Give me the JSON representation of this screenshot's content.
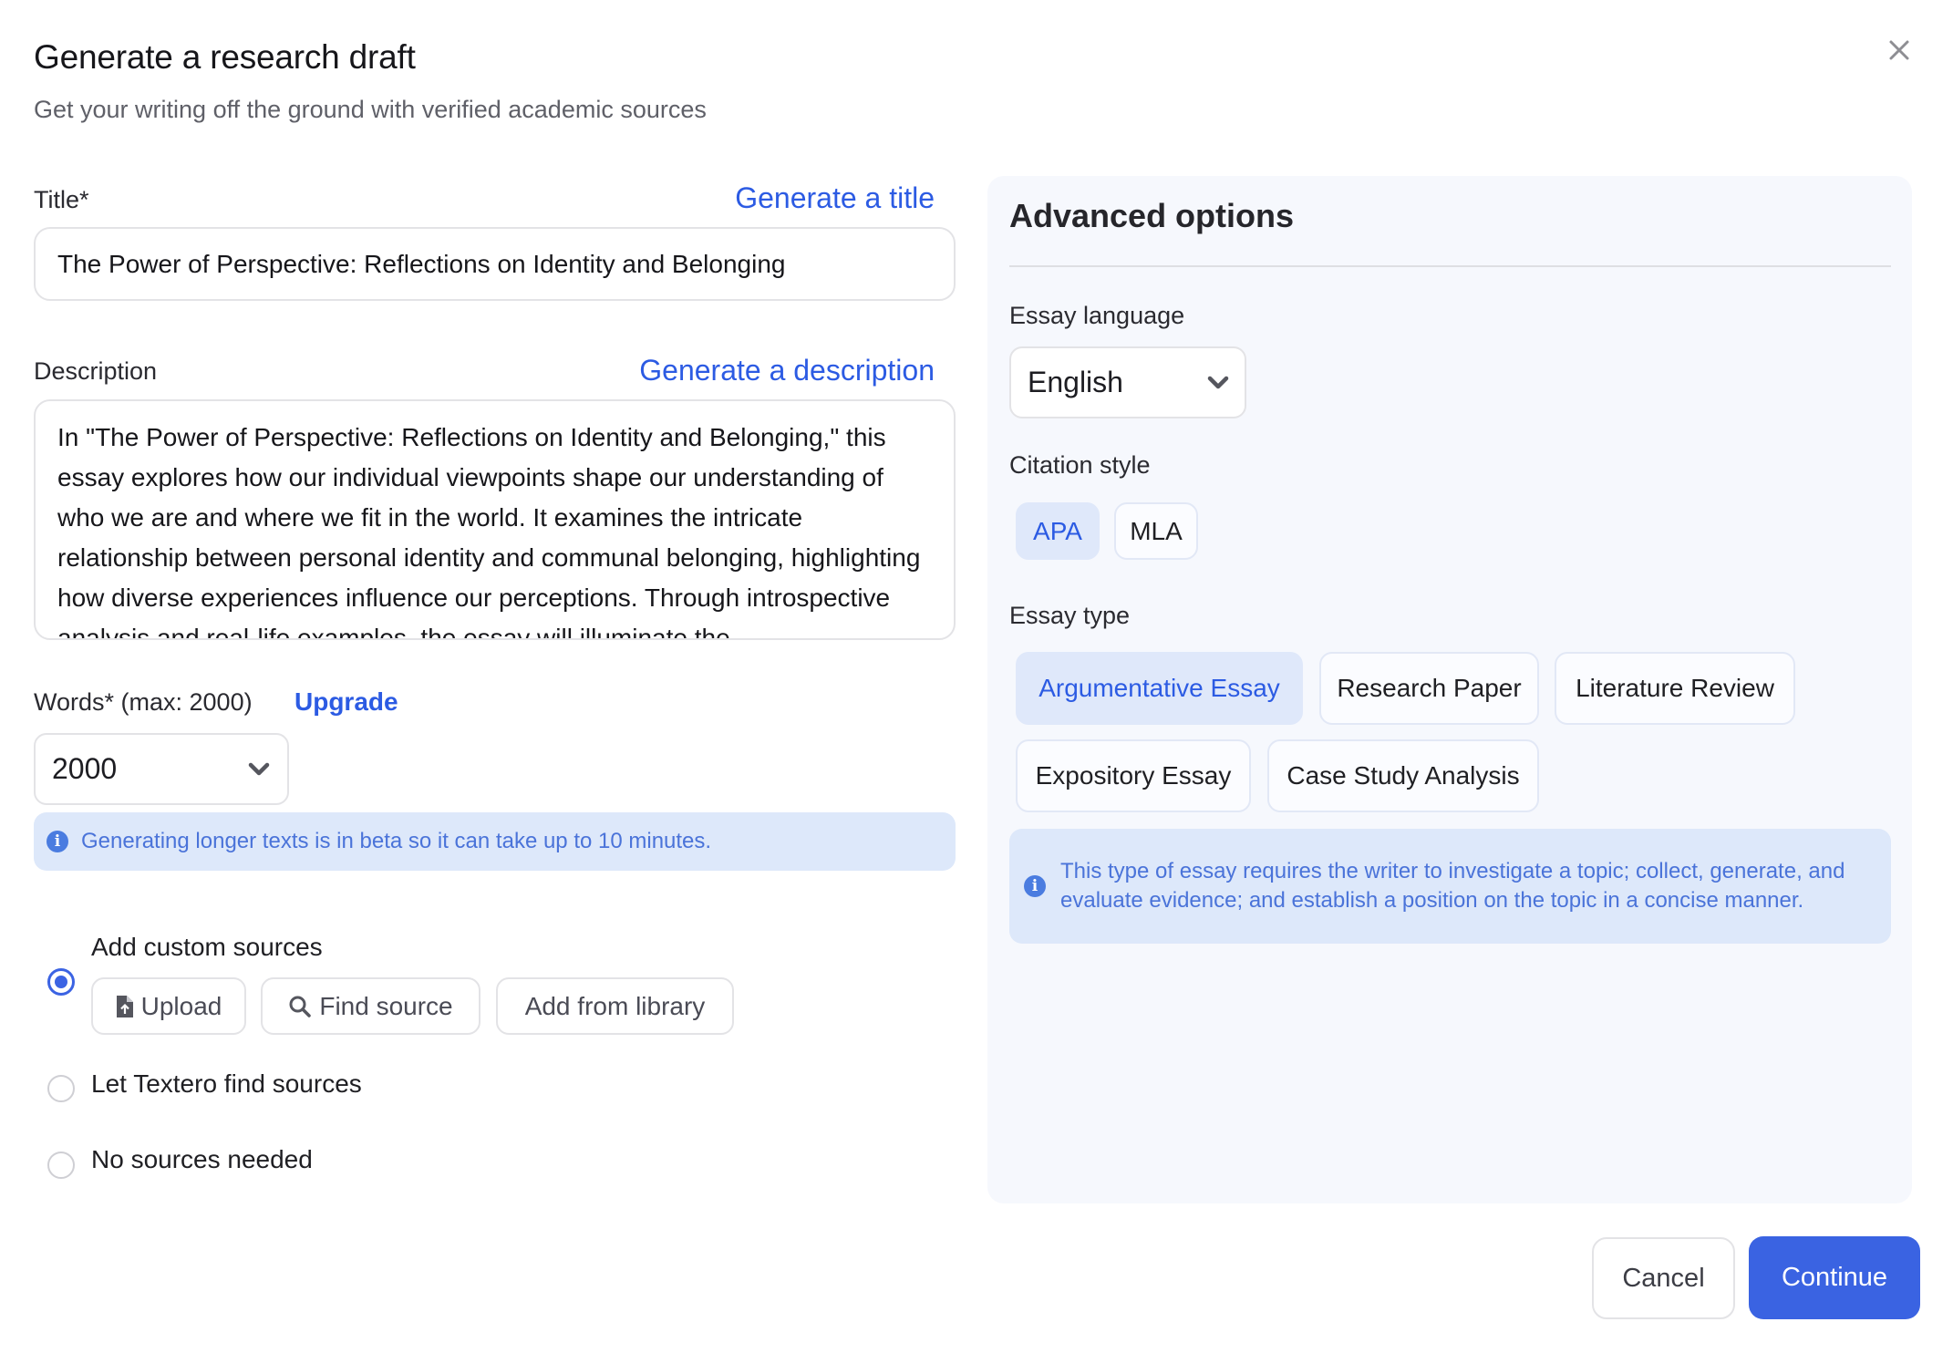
{
  "dialog": {
    "title": "Generate a research draft",
    "subtitle": "Get your writing off the ground with verified academic sources",
    "close_icon": "close-icon"
  },
  "title_field": {
    "label": "Title*",
    "generate_link": "Generate a title",
    "value": "The Power of Perspective: Reflections on Identity and Belonging"
  },
  "description_field": {
    "label": "Description",
    "generate_link": "Generate a description",
    "value": "In \"The Power of Perspective: Reflections on Identity and Belonging,\" this essay explores how our individual viewpoints shape our understanding of who we are and where we fit in the world. It examines the intricate relationship between personal identity and communal belonging, highlighting how diverse experiences influence our perceptions. Through introspective analysis and real-life examples, the essay will illuminate the"
  },
  "words_field": {
    "label": "Words* (max: 2000)",
    "upgrade_link": "Upgrade",
    "value": "2000"
  },
  "beta_notice": {
    "icon": "info-icon",
    "text": "Generating longer texts is in beta so it can take up to 10 minutes."
  },
  "sources": {
    "options": [
      {
        "label": "Add custom sources",
        "selected": true
      },
      {
        "label": "Let Textero find sources",
        "selected": false
      },
      {
        "label": "No sources needed",
        "selected": false
      }
    ],
    "buttons": {
      "upload": "Upload",
      "find_source": "Find source",
      "add_from_library": "Add from library"
    }
  },
  "advanced": {
    "title": "Advanced options",
    "language_label": "Essay language",
    "language_value": "English",
    "citation_label": "Citation style",
    "citation_options": [
      {
        "label": "APA",
        "selected": true
      },
      {
        "label": "MLA",
        "selected": false
      }
    ],
    "essay_type_label": "Essay type",
    "essay_types": [
      {
        "label": "Argumentative Essay",
        "selected": true
      },
      {
        "label": "Research Paper",
        "selected": false
      },
      {
        "label": "Literature Review",
        "selected": false
      },
      {
        "label": "Expository Essay",
        "selected": false
      },
      {
        "label": "Case Study Analysis",
        "selected": false
      }
    ],
    "essay_type_info": "This type of essay requires the writer to investigate a topic; collect, generate, and evaluate evidence; and establish a position on the topic in a concise manner."
  },
  "footer": {
    "cancel": "Cancel",
    "continue": "Continue"
  },
  "colors": {
    "accent": "#3a63e2",
    "link": "#2c5be3",
    "info_bg": "#dde8fa",
    "panel_bg": "#f6f8fd"
  }
}
